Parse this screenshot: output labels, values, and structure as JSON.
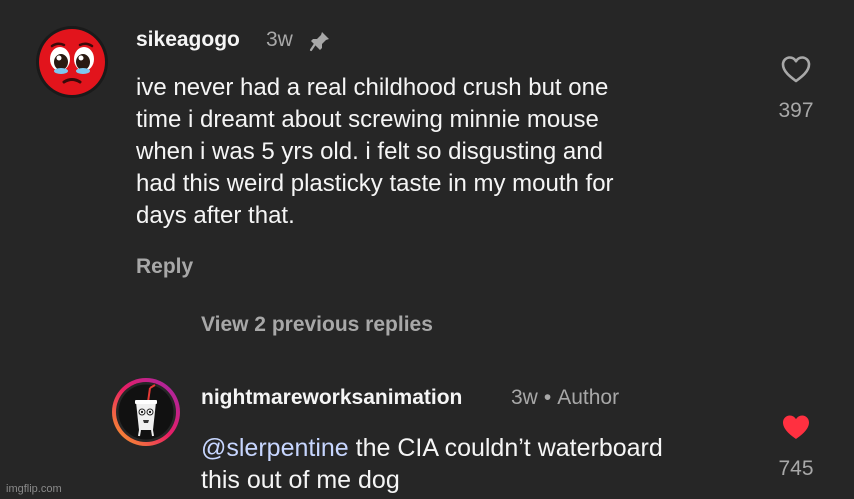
{
  "comment": {
    "username": "sikeagogo",
    "time": "3w",
    "pinned_icon": "pin-icon",
    "text_lines": [
      "ive never had a real childhood crush but one",
      "time i dreamt about screwing minnie mouse",
      "when i was 5 yrs old. i felt so disgusting and",
      "had this weird plasticky taste in my mouth for",
      "days after that."
    ],
    "reply_label": "Reply",
    "likes": "397",
    "like_icon": "heart-outline-icon"
  },
  "view_replies_label": "View 2 previous replies",
  "reply_comment": {
    "username": "nightmareworksanimation",
    "time": "3w",
    "separator": "•",
    "badge": "Author",
    "mention": "@slerpentine",
    "text_after_mention": " the CIA couldn’t waterboard",
    "text_line2": "this out of me dog",
    "likes": "745",
    "like_icon": "heart-filled-icon",
    "like_color": "#ff3040"
  },
  "watermark": "imgflip.com",
  "colors": {
    "background": "#262626",
    "primary_text": "#f5f5f5",
    "secondary_text": "#a8a8a8",
    "heart_red": "#ff3040"
  }
}
